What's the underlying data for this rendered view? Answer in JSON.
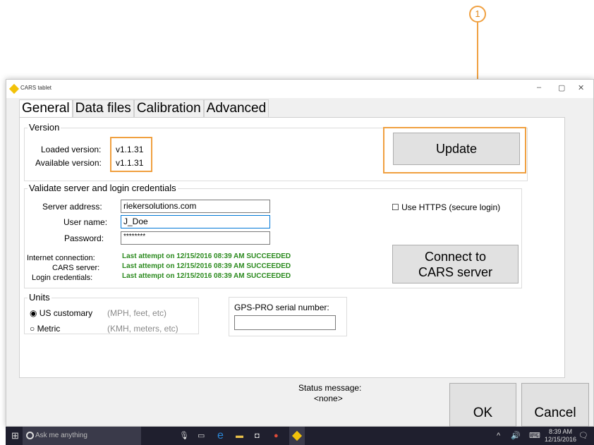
{
  "callout": {
    "number": "1"
  },
  "window": {
    "title": "CARS tablet",
    "minimize": "–",
    "maximize": "▢",
    "close": "✕"
  },
  "tabs": [
    "General",
    "Data files",
    "Calibration",
    "Advanced"
  ],
  "version": {
    "group_title": "Version",
    "loaded_label": "Loaded version:",
    "loaded_value": "v1.1.31",
    "available_label": "Available version:",
    "available_value": "v1.1.31",
    "update_button": "Update"
  },
  "credentials": {
    "group_title": "Validate server and login credentials",
    "server_label": "Server address:",
    "server_value": "riekersolutions.com",
    "user_label": "User name:",
    "user_value": "J_Doe",
    "password_label": "Password:",
    "password_value": "********",
    "https_checkbox": "☐ Use HTTPS (secure login)",
    "internet_label": "Internet connection:",
    "cars_label": "CARS server:",
    "login_label": "Login credentials:",
    "internet_status": "Last attempt on 12/15/2016 08:39 AM SUCCEEDED",
    "cars_status": "Last attempt on 12/15/2016 08:39 AM SUCCEEDED",
    "login_status": "Last attempt on 12/15/2016 08:39 AM SUCCEEDED",
    "connect_line1": "Connect to",
    "connect_line2": "CARS server"
  },
  "units": {
    "group_title": "Units",
    "us_radio": "◉ US customary",
    "us_desc": "(MPH, feet, etc)",
    "metric_radio": "○ Metric",
    "metric_desc": "(KMH, meters, etc)"
  },
  "gps": {
    "label": "GPS-PRO serial number:",
    "value": ""
  },
  "footer": {
    "status_label": "Status message:",
    "status_value": "<none>",
    "ok_button": "OK",
    "cancel_button": "Cancel"
  },
  "taskbar": {
    "search_placeholder": "Ask me anything",
    "time": "8:39 AM",
    "date": "12/15/2016"
  }
}
